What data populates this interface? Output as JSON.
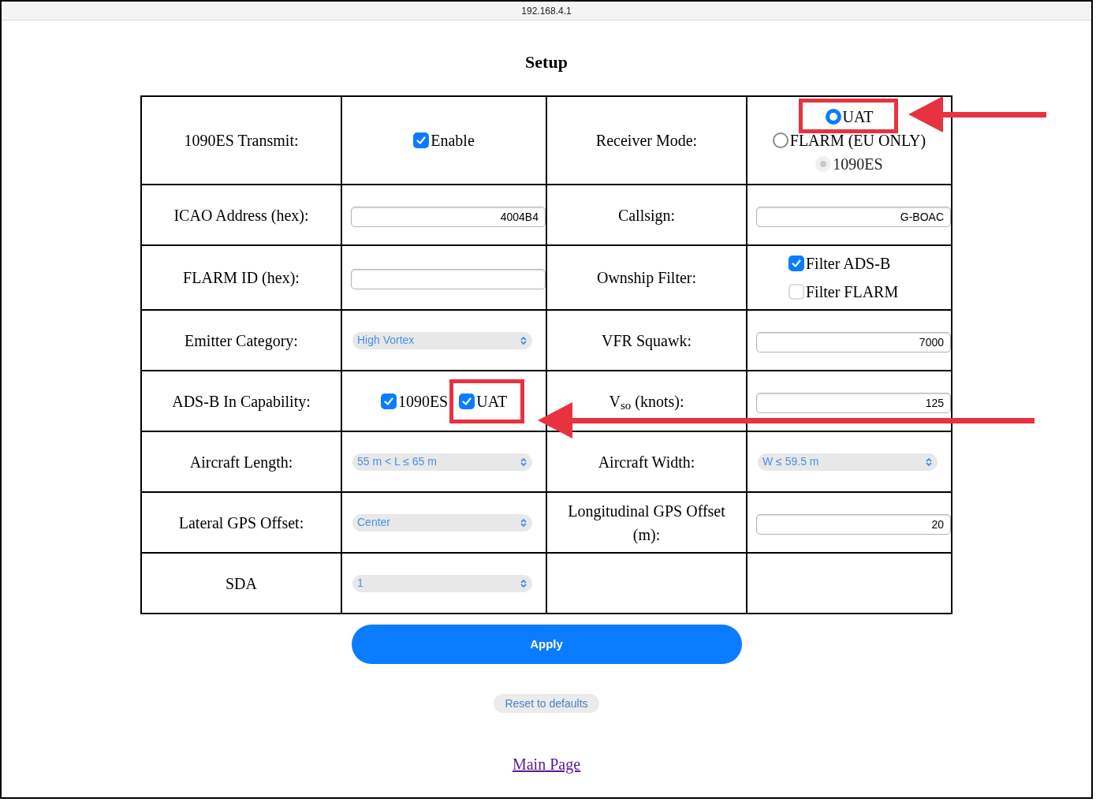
{
  "browser": {
    "address": "192.168.4.1"
  },
  "title": "Setup",
  "rows": [
    {
      "cells": [
        {
          "label": "1090ES Transmit:",
          "control": {
            "kind": "checkbox_row",
            "options": [
              {
                "label": "Enable",
                "checked": true,
                "highlighted": false
              }
            ]
          }
        },
        {
          "label": "Receiver Mode:",
          "control": {
            "kind": "radios",
            "options": [
              {
                "label": "UAT",
                "selected": true,
                "disabled": false,
                "highlighted": true
              },
              {
                "label": "FLARM (EU ONLY)",
                "selected": false,
                "disabled": false,
                "highlighted": false
              },
              {
                "label": "1090ES",
                "selected": false,
                "disabled": true,
                "highlighted": false
              }
            ]
          }
        }
      ]
    },
    {
      "cells": [
        {
          "label": "ICAO Address (hex):",
          "control": {
            "kind": "text",
            "value": "4004B4"
          }
        },
        {
          "label": "Callsign:",
          "control": {
            "kind": "text",
            "value": "G-BOAC"
          }
        }
      ]
    },
    {
      "cells": [
        {
          "label": "FLARM ID (hex):",
          "control": {
            "kind": "text"
          }
        },
        {
          "label": "Ownship Filter:",
          "control": {
            "kind": "checkbox_column",
            "options": [
              {
                "label": "Filter ADS-B",
                "checked": true,
                "highlighted": false
              },
              {
                "label": "Filter FLARM",
                "checked": false,
                "highlighted": false
              }
            ]
          }
        }
      ]
    },
    {
      "cells": [
        {
          "label": "Emitter Category:",
          "control": {
            "kind": "select",
            "value": "High Vortex"
          }
        },
        {
          "label": "VFR Squawk:",
          "control": {
            "kind": "text",
            "value": "7000"
          }
        }
      ]
    },
    {
      "cells": [
        {
          "label": "ADS-B In Capability:",
          "control": {
            "kind": "checkbox_row",
            "options": [
              {
                "label": "1090ES",
                "checked": true,
                "highlighted": false
              },
              {
                "label": "UAT",
                "checked": true,
                "highlighted": true
              }
            ]
          }
        },
        {
          "label": "V$_{so}$ (knots):",
          "control": {
            "kind": "text",
            "value": "125"
          }
        }
      ]
    },
    {
      "cells": [
        {
          "label": "Aircraft Length:",
          "control": {
            "kind": "select",
            "value": "55 m < L ≤ 65 m"
          }
        },
        {
          "label": "Aircraft Width:",
          "control": {
            "kind": "select",
            "value": "W ≤ 59.5 m"
          }
        }
      ]
    },
    {
      "cells": [
        {
          "label": "Lateral GPS Offset:",
          "control": {
            "kind": "select",
            "value": "Center"
          }
        },
        {
          "label": "Longitudinal GPS Offset (m):",
          "control": {
            "kind": "text",
            "value": "20"
          }
        }
      ]
    },
    {
      "cells": [
        {
          "label": "SDA",
          "control": {
            "kind": "select",
            "value": "1"
          }
        }
      ]
    }
  ],
  "apply_button": "Apply",
  "reset_button": "Reset to defaults",
  "main_page_link": "Main Page"
}
